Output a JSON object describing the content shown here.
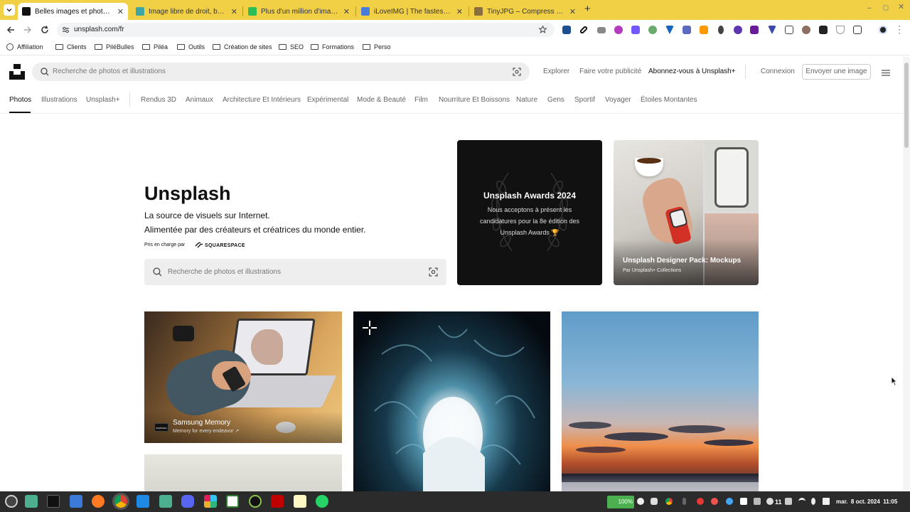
{
  "browser": {
    "tabs": [
      {
        "title": "Belles images et photos gra",
        "active": true,
        "fav_color": "#111111"
      },
      {
        "title": "Image libre de droit, banque",
        "active": false,
        "fav_color": "#3fa6a1"
      },
      {
        "title": "Plus d'un million d'images (li",
        "active": false,
        "fav_color": "#2dbd55"
      },
      {
        "title": "iLoveIMG | The fastest free",
        "active": false,
        "fav_color": "#4a7bd8"
      },
      {
        "title": "TinyJPG – Compress WebP,",
        "active": false,
        "fav_color": "#8a6f3e"
      }
    ],
    "url": "unsplash.com/fr",
    "bookmarks": [
      {
        "label": "Affiliation",
        "icon": "globe-icon"
      },
      {
        "label": "Clients",
        "icon": "folder-icon"
      },
      {
        "label": "PiléBulles",
        "icon": "folder-icon"
      },
      {
        "label": "Piléa",
        "icon": "folder-icon"
      },
      {
        "label": "Outils",
        "icon": "folder-icon"
      },
      {
        "label": "Création de sites",
        "icon": "folder-icon"
      },
      {
        "label": "SEO",
        "icon": "folder-icon"
      },
      {
        "label": "Formations",
        "icon": "folder-icon"
      },
      {
        "label": "Perso",
        "icon": "folder-icon"
      }
    ]
  },
  "site": {
    "search_placeholder": "Recherche de photos et illustrations",
    "nav": {
      "explore": "Explorer",
      "advertise": "Faire votre publicité",
      "subscribe": "Abonnez-vous à Unsplash+",
      "login": "Connexion",
      "submit": "Envoyer une image"
    },
    "categories": [
      "Photos",
      "Illustrations",
      "Unsplash+",
      "Rendus 3D",
      "Animaux",
      "Architecture Et Intérieurs",
      "Expérimental",
      "Mode & Beauté",
      "Film",
      "Nourriture Et Boissons",
      "Nature",
      "Gens",
      "Sportif",
      "Voyager",
      "Étoiles Montantes"
    ],
    "active_category": "Photos"
  },
  "hero": {
    "title": "Unsplash",
    "line1": "La source de visuels sur Internet.",
    "line2": "Alimentée par des créateurs et créatrices du monde entier.",
    "powered_by": "Pris en charge par",
    "sponsor": "SQUARESPACE",
    "search_placeholder": "Recherche de photos et illustrations"
  },
  "cards": {
    "awards": {
      "title": "Unsplash Awards 2024",
      "body": "Nous acceptons à présent les candidatures pour la 8e édition des Unsplash Awards 🏆"
    },
    "designer": {
      "title": "Unsplash Designer Pack: Mockups",
      "subtitle": "Par Unsplash+ Collections"
    }
  },
  "photos": {
    "samsung_title": "Samsung Memory",
    "samsung_sub": "Memory for every endeavor ↗",
    "samsung_logo": "SAMSUNG"
  },
  "taskbar": {
    "battery": "100%",
    "notif_count": "11",
    "clock": "mar.  8 oct. 2024  11:05"
  },
  "colors": {
    "tabstrip": "#f2d046",
    "taskbar": "#2b2b2b",
    "accent": "#111111"
  }
}
